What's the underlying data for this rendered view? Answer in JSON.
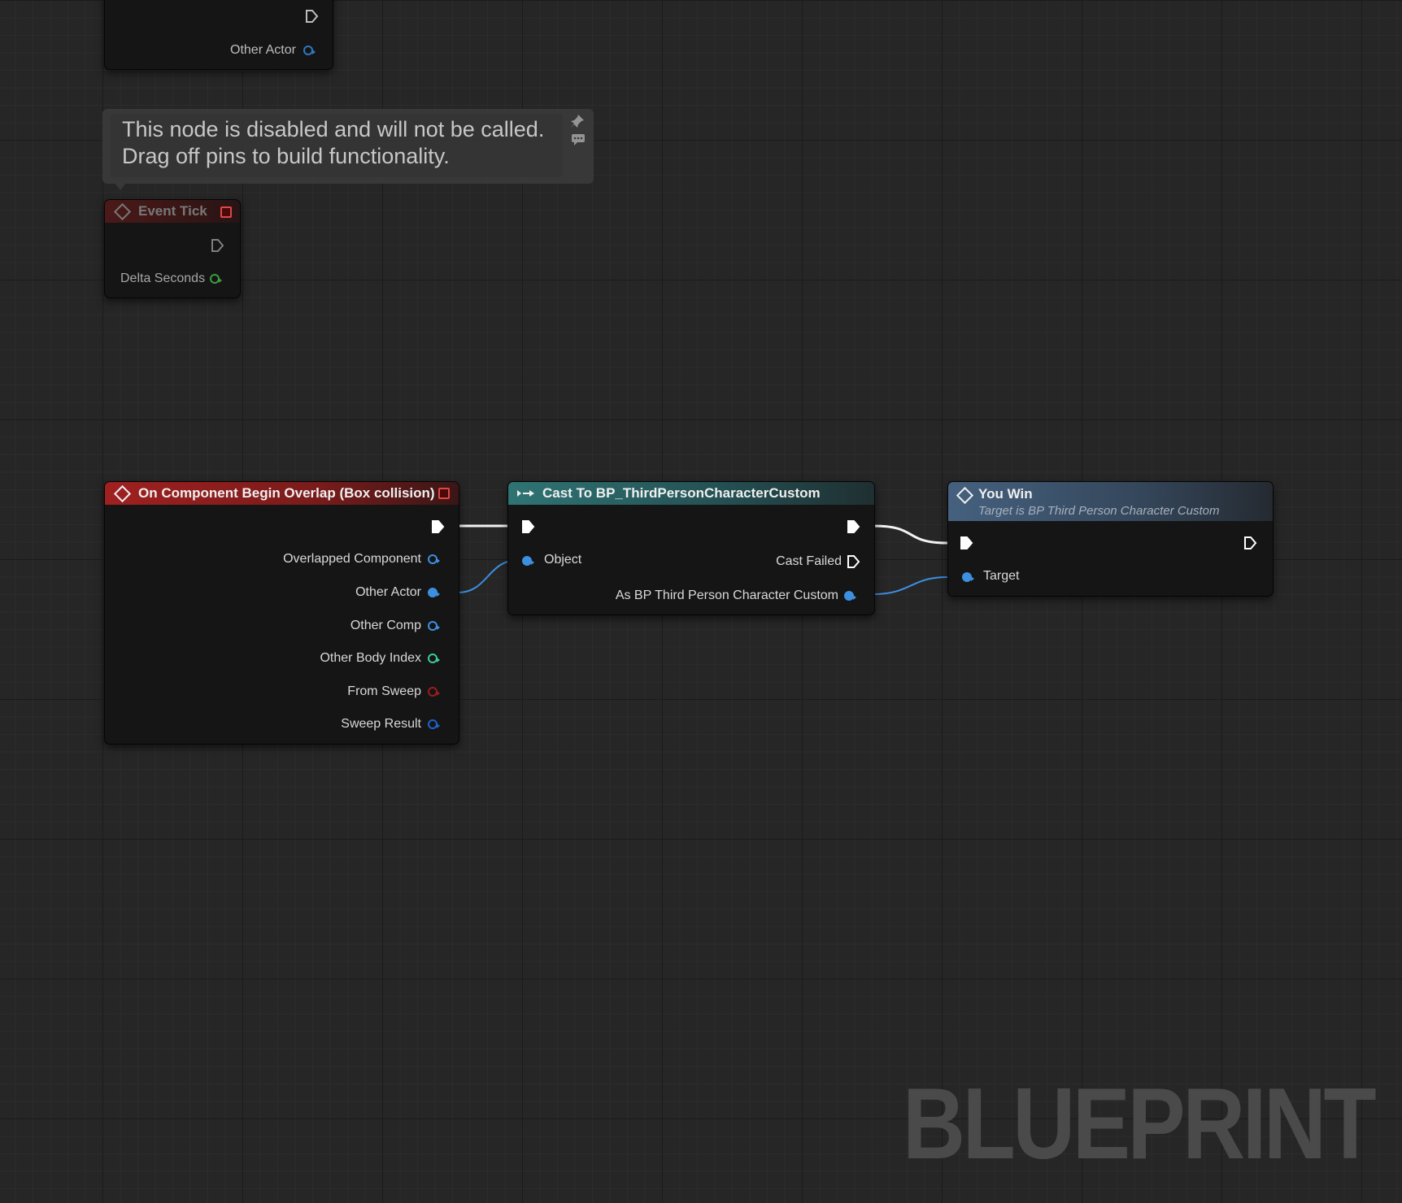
{
  "graph": {
    "watermark": "BLUEPRINT"
  },
  "partial_node": {
    "pin_other_actor": "Other Actor"
  },
  "comment": {
    "line1": "This node is disabled and will not be called.",
    "line2": "Drag off pins to build functionality."
  },
  "event_tick": {
    "title": "Event Tick",
    "pin_delta_seconds": "Delta Seconds"
  },
  "overlap_event": {
    "title": "On Component Begin Overlap (Box collision)",
    "pins": [
      {
        "label": "Overlapped Component",
        "color": "#3d8fe0"
      },
      {
        "label": "Other Actor",
        "color": "#3d8fe0"
      },
      {
        "label": "Other Comp",
        "color": "#3d8fe0"
      },
      {
        "label": "Other Body Index",
        "color": "#3ec9a0"
      },
      {
        "label": "From Sweep",
        "color": "#9b1c1c"
      },
      {
        "label": "Sweep Result",
        "color": "#1f62c8"
      }
    ]
  },
  "cast_node": {
    "title": "Cast To BP_ThirdPersonCharacterCustom",
    "pin_object": "Object",
    "pin_cast_failed": "Cast Failed",
    "pin_as": "As BP Third Person Character Custom"
  },
  "you_win_node": {
    "title": "You Win",
    "subtitle": "Target is BP Third Person Character Custom",
    "pin_target": "Target"
  },
  "colors": {
    "event_header": "#8e1f1f",
    "cast_header": "#2b6b6b",
    "function_header": "#3f5a78",
    "object_pin": "#3d8fe0",
    "exec_pin": "#ffffff"
  }
}
